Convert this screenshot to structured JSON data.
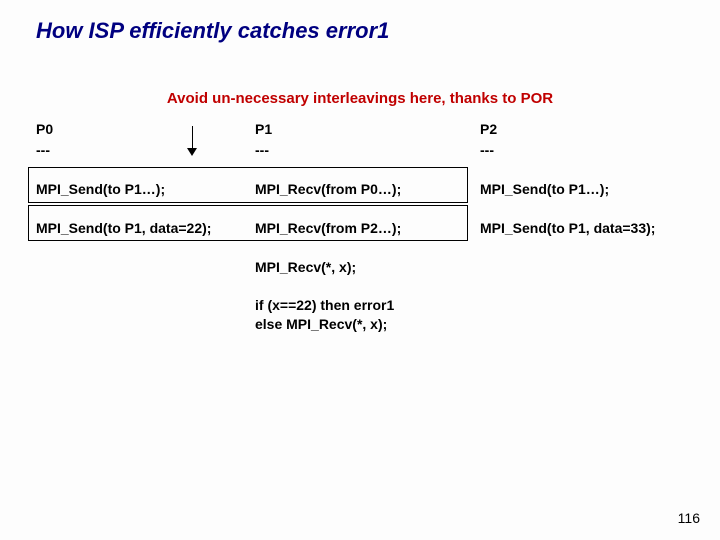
{
  "title": "How  ISP efficiently catches error1",
  "subtitle": "Avoid un-necessary interleavings here, thanks to POR",
  "columns": {
    "p0": {
      "header": "P0",
      "dash": "---",
      "lines": [
        "MPI_Send(to P1…);",
        "MPI_Send(to P1, data=22);"
      ]
    },
    "p1": {
      "header": "P1",
      "dash": "---",
      "lines": [
        "MPI_Recv(from P0…);",
        "MPI_Recv(from P2…);",
        "MPI_Recv(*, x);",
        "if (x==22) then error1",
        " else MPI_Recv(*, x);"
      ]
    },
    "p2": {
      "header": "P2",
      "dash": "---",
      "lines": [
        "MPI_Send(to P1…);",
        "MPI_Send(to P1, data=33);"
      ]
    }
  },
  "page_number": "116"
}
